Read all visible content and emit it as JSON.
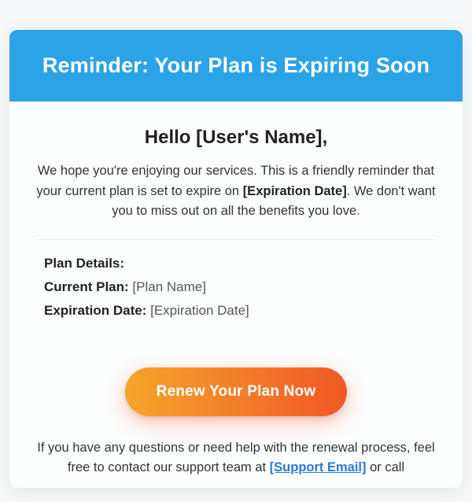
{
  "banner": {
    "title": "Reminder: Your Plan is Expiring Soon"
  },
  "greeting": {
    "hello": "Hello ",
    "name_placeholder": "[User's Name]",
    "suffix": ","
  },
  "intro": {
    "part1": "We hope you're enjoying our services. This is a friendly reminder that your current plan is set to expire on ",
    "date_placeholder": "[Expiration Date]",
    "part2": ". We don't want you to miss out on all the benefits you love."
  },
  "details": {
    "heading": "Plan Details:",
    "plan_label": "Current Plan:",
    "plan_value": "[Plan Name]",
    "exp_label": "Expiration Date:",
    "exp_value": "[Expiration Date]"
  },
  "cta": {
    "label": "Renew Your Plan Now"
  },
  "help": {
    "part1": "If you have any questions or need help with the renewal process, feel free to contact our support team at ",
    "email_placeholder": "[Support Email]",
    "part2": " or call"
  }
}
